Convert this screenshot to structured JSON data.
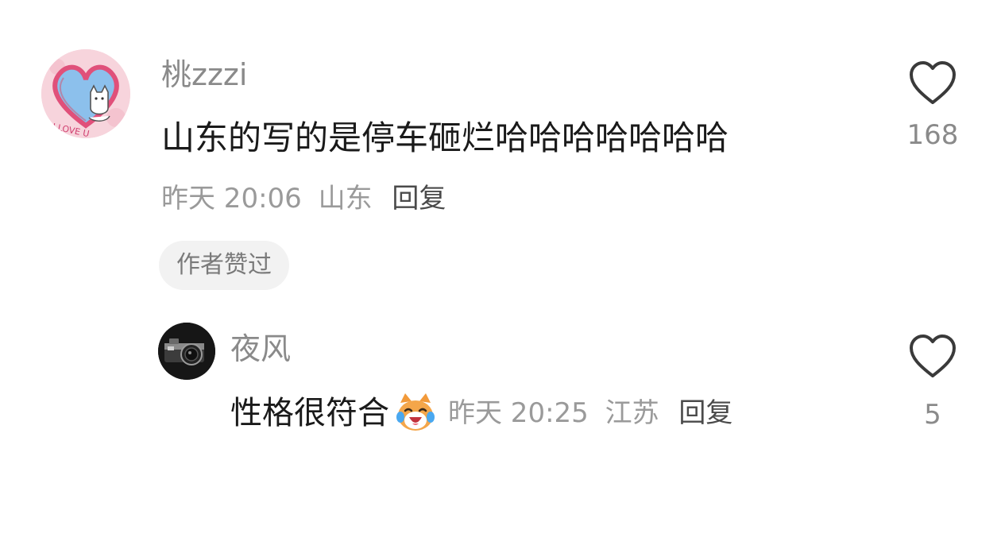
{
  "comment": {
    "username": "桃zzzi",
    "text": "山东的写的是停车砸烂哈哈哈哈哈哈哈",
    "time": "昨天 20:06",
    "location": "山东",
    "reply_label": "回复",
    "author_liked_badge": "作者赞过",
    "like_count": "168",
    "avatar_icon": "heart-cat-avatar",
    "heart_icon": "heart-outline-icon"
  },
  "reply": {
    "username": "夜风",
    "text": "性格很符合",
    "emoji": "laughing-cat-emoji",
    "time": "昨天 20:25",
    "location": "江苏",
    "reply_label": "回复",
    "like_count": "5",
    "avatar_icon": "camera-avatar",
    "heart_icon": "heart-outline-icon"
  },
  "colors": {
    "text_primary": "#1a1a1a",
    "text_secondary": "#9a9a9a",
    "badge_bg": "#f2f2f2"
  }
}
